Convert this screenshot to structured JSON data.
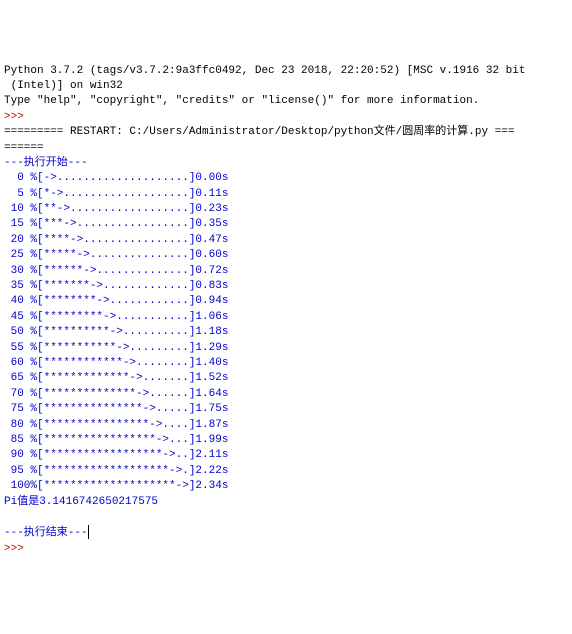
{
  "header": {
    "line1": "Python 3.7.2 (tags/v3.7.2:9a3ffc0492, Dec 23 2018, 22:20:52) [MSC v.1916 32 bit",
    "line2": " (Intel)] on win32",
    "line3": "Type \"help\", \"copyright\", \"credits\" or \"license()\" for more information."
  },
  "prompt": ">>> ",
  "restart": {
    "line1": "========= RESTART: C:/Users/Administrator/Desktop/python文件/圆周率的计算.py ===",
    "line2": "======"
  },
  "exec_start": "---执行开始---",
  "progress": [
    "  0 %[->....................]0.00s",
    "  5 %[*->...................]0.11s",
    " 10 %[**->..................]0.23s",
    " 15 %[***->.................]0.35s",
    " 20 %[****->................]0.47s",
    " 25 %[*****->...............]0.60s",
    " 30 %[******->..............]0.72s",
    " 35 %[*******->.............]0.83s",
    " 40 %[********->............]0.94s",
    " 45 %[*********->...........]1.06s",
    " 50 %[**********->..........]1.18s",
    " 55 %[***********->.........]1.29s",
    " 60 %[************->........]1.40s",
    " 65 %[*************->.......]1.52s",
    " 70 %[**************->......]1.64s",
    " 75 %[***************->.....]1.75s",
    " 80 %[****************->....]1.87s",
    " 85 %[*****************->...]1.99s",
    " 90 %[******************->..]2.11s",
    " 95 %[*******************->.]2.22s",
    " 100%[********************->]2.34s"
  ],
  "result": "Pi值是3.1416742650217575",
  "exec_end": "---执行结束---",
  "blank": ""
}
